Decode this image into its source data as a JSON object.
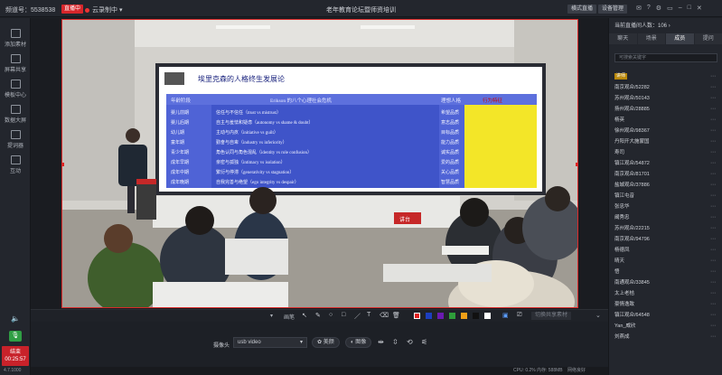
{
  "topbar": {
    "channel": "频道号：5538538",
    "live_badge": "直播中",
    "cloud_record": "云录制中",
    "title": "老年教育论坛暨师资培训",
    "switch_btn": "横式直播",
    "settings_btn": "设备管理"
  },
  "sidebar": {
    "items": [
      {
        "label": "添加素材"
      },
      {
        "label": "屏幕共享"
      },
      {
        "label": "模板中心"
      },
      {
        "label": "数据大屏"
      },
      {
        "label": "提词器"
      },
      {
        "label": "互动"
      }
    ],
    "live_button": {
      "label": "结束",
      "time": "00:25:57"
    }
  },
  "toolbar": {
    "brush_label": "画笔",
    "share_label": "切换共享素材"
  },
  "camera": {
    "label": "摄像头",
    "device": "usb video",
    "beauty": "美颜",
    "image": "图像"
  },
  "status": {
    "version": "4.7.1000",
    "cpu": "CPU: 0.2%",
    "memory": "内存: 588MB",
    "network": "网络良好"
  },
  "right_panel": {
    "viewers": "当前直播间人数：106",
    "tabs": [
      {
        "label": "聊天"
      },
      {
        "label": "场景"
      },
      {
        "label": "成员"
      },
      {
        "label": "提问"
      }
    ],
    "search_placeholder": "可搜索关键字",
    "members": [
      {
        "name": "讲师",
        "role": "讲师"
      },
      {
        "name": "南京观众/52282"
      },
      {
        "name": "苏州观众/50143"
      },
      {
        "name": "扬州观众/28885"
      },
      {
        "name": "杨英"
      },
      {
        "name": "徐州观众/98367"
      },
      {
        "name": "丹阳开大施蒙国"
      },
      {
        "name": "寿司"
      },
      {
        "name": "镇江观众/54872"
      },
      {
        "name": "南京观众/81701"
      },
      {
        "name": "盐城观众/37886"
      },
      {
        "name": "镇江屯音"
      },
      {
        "name": "张忠华"
      },
      {
        "name": "阚秀忠"
      },
      {
        "name": "苏州观众/22215"
      },
      {
        "name": "南京观众/94796"
      },
      {
        "name": "杨德凤"
      },
      {
        "name": "晴天"
      },
      {
        "name": "悟"
      },
      {
        "name": "南通观众/33845"
      },
      {
        "name": "太上老桔"
      },
      {
        "name": "豪情逸致"
      },
      {
        "name": "镇江观众/64548"
      },
      {
        "name": "Yan_威欣"
      },
      {
        "name": "刘燕成"
      }
    ]
  },
  "slide": {
    "title": "埃里克森的人格终生发展论",
    "col_headers": [
      "年龄阶段",
      "Erikson 的八个心理社会危机",
      "理想人格",
      "行为特征"
    ],
    "rows": [
      [
        "婴儿前期",
        "信任与不信任（trust vs mistrust）",
        "希望品质"
      ],
      [
        "婴儿后期",
        "自主与羞怯和疑虑（autonomy vs shame & doubt）",
        "意志品质"
      ],
      [
        "幼儿期",
        "主动与内疚（initiative vs guilt）",
        "目标品质"
      ],
      [
        "童年期",
        "勤奋与自卑（industry vs inferiority）",
        "能力品质"
      ],
      [
        "青少年期",
        "角色认同与角色混乱（identity vs role confusion）",
        "诚实品质"
      ],
      [
        "成年早期",
        "亲密与孤独（intimacy vs isolation）",
        "爱的品质"
      ],
      [
        "成年中期",
        "繁衍与停滞（generativity vs stagnation）",
        "关心品质"
      ],
      [
        "成年晚期",
        "自我完善与绝望（ego integrity vs despair）",
        "智慧品质"
      ]
    ],
    "lectern": "讲台",
    "nameplate": "背景"
  },
  "colors": {
    "accent_red": "#d92a2a",
    "slide_blue": "#4f63d6",
    "slide_yellow": "#f3e628"
  }
}
